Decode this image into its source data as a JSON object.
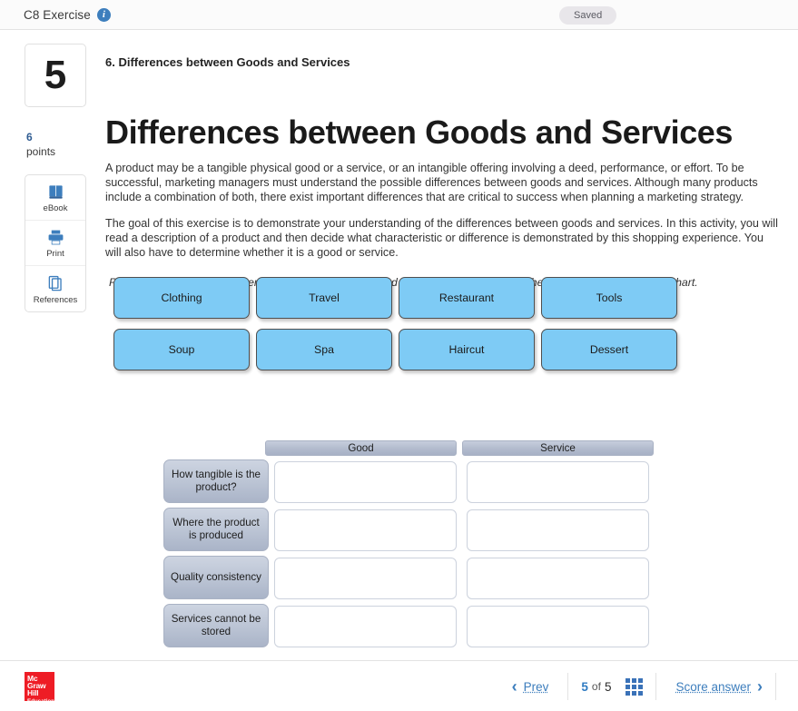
{
  "topbar": {
    "title": "C8 Exercise",
    "info_icon": "info-icon",
    "status_badge": "Saved"
  },
  "sidebar": {
    "question_number": "5",
    "points_value": "6",
    "points_label": "points",
    "tools": [
      {
        "label": "eBook",
        "icon": "book-icon"
      },
      {
        "label": "Print",
        "icon": "printer-icon"
      },
      {
        "label": "References",
        "icon": "documents-icon"
      }
    ]
  },
  "main": {
    "subtitle": "6. Differences between Goods and Services",
    "title": "Differences between Goods and Services",
    "paragraph1": "A product may be a tangible physical good or a service, or an intangible offering involving a deed, performance, or effort. To be successful, marketing managers must understand the possible differences between goods and services. Although many products include a combination of both, there exist important differences that are critical to success when planning a marketing strategy.",
    "paragraph2": "The goal of this exercise is to demonstrate your understanding of the differences between goods and services. In this activity, you will read a description of a product and then decide what characteristic or difference is demonstrated by this shopping experience. You will also have to determine whether it is a good or service.",
    "instruction": "Roll your cursor over each item to read its description, and then drag and drop it into the appropriate place on the chart."
  },
  "tiles": {
    "row1": [
      "Clothing",
      "Travel",
      "Restaurant",
      "Tools"
    ],
    "row2": [
      "Soup",
      "Spa",
      "Haircut",
      "Dessert"
    ]
  },
  "matrix": {
    "columns": [
      "Good",
      "Service"
    ],
    "rows": [
      "How tangible is the product?",
      "Where the product is produced",
      "Quality consistency",
      "Services cannot be stored"
    ],
    "cells": [
      [
        "",
        ""
      ],
      [
        "",
        ""
      ],
      [
        "",
        ""
      ],
      [
        "",
        ""
      ]
    ]
  },
  "footer": {
    "logo_line1": "Mc",
    "logo_line2": "Graw",
    "logo_line3": "Hill",
    "logo_line4": "Education",
    "prev_label": "Prev",
    "page_current": "5",
    "page_of": "of",
    "page_total": "5",
    "grid_icon": "grid-icon",
    "score_label": "Score answer",
    "next_icon": "chevron-right-icon",
    "prev_icon": "chevron-left-icon"
  },
  "colors": {
    "accent_blue": "#3d7ebd",
    "tile_blue": "#7ecbf5",
    "header_grey": "#b2bbcd",
    "logo_red": "#ee1c25"
  }
}
